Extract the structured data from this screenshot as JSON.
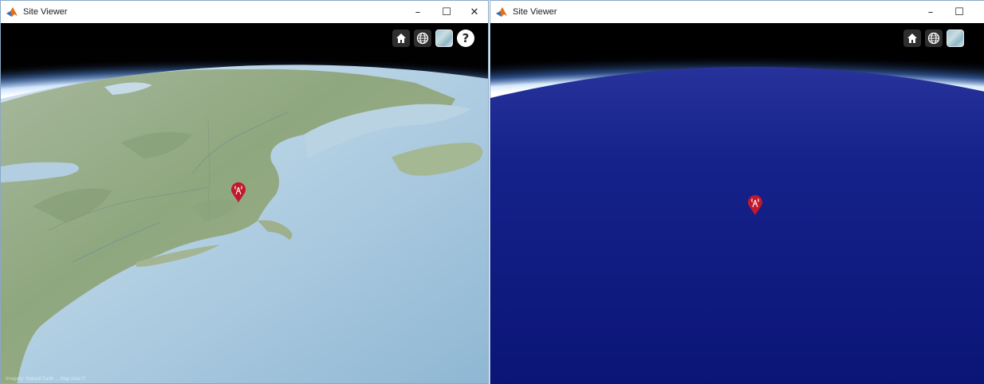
{
  "windows": [
    {
      "title": "Site Viewer",
      "controls": {
        "minimize": "–",
        "maximize": "☐",
        "close": "✕"
      },
      "toolbar": [
        "home-icon",
        "globe-icon",
        "basemap-picker-icon",
        "help-icon"
      ],
      "help_label": "?",
      "basemap": "terrain",
      "attribution": "Imagery: Natural Earth ... Map data ©"
    },
    {
      "title": "Site Viewer",
      "controls": {
        "minimize": "–",
        "maximize": "☐"
      },
      "toolbar": [
        "home-icon",
        "globe-icon",
        "basemap-picker-icon"
      ],
      "basemap": "dark-blue"
    }
  ],
  "markers": [
    {
      "window": 0,
      "icon": "antenna-site-icon"
    },
    {
      "window": 1,
      "icon": "antenna-site-icon"
    }
  ],
  "colors": {
    "marker": "#c0182c",
    "space": "#000000",
    "ocean_light": "#b8d4e6",
    "ocean_dark": "#0d1a7e",
    "atmosphere": "#d9ecff",
    "toolbar_button": "#2e2e2e"
  }
}
